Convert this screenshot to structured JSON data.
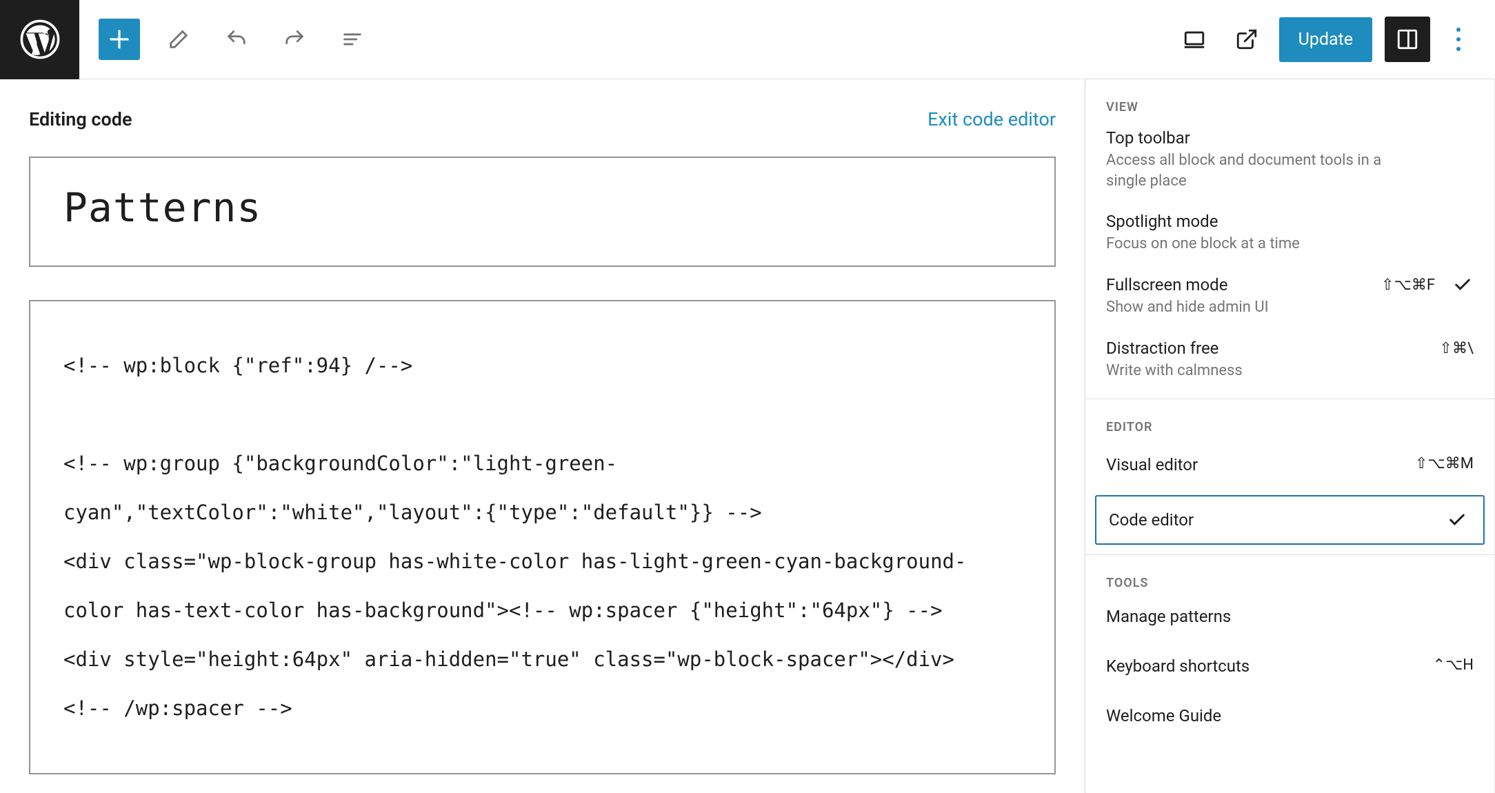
{
  "topbar": {
    "update_label": "Update"
  },
  "editor": {
    "editing_label": "Editing code",
    "exit_link": "Exit code editor",
    "title": "Patterns",
    "code": "<!-- wp:block {\"ref\":94} /-->\n\n<!-- wp:group {\"backgroundColor\":\"light-green-cyan\",\"textColor\":\"white\",\"layout\":{\"type\":\"default\"}} -->\n<div class=\"wp-block-group has-white-color has-light-green-cyan-background-color has-text-color has-background\"><!-- wp:spacer {\"height\":\"64px\"} -->\n<div style=\"height:64px\" aria-hidden=\"true\" class=\"wp-block-spacer\"></div>\n<!-- /wp:spacer -->"
  },
  "panel": {
    "view_label": "VIEW",
    "editor_label": "EDITOR",
    "tools_label": "TOOLS",
    "view_items": [
      {
        "title": "Top toolbar",
        "sub": "Access all block and document tools in a single place",
        "shortcut": "",
        "checked": false
      },
      {
        "title": "Spotlight mode",
        "sub": "Focus on one block at a time",
        "shortcut": "",
        "checked": false
      },
      {
        "title": "Fullscreen mode",
        "sub": "Show and hide admin UI",
        "shortcut": "⇧⌥⌘F",
        "checked": true
      },
      {
        "title": "Distraction free",
        "sub": "Write with calmness",
        "shortcut": "⇧⌘\\",
        "checked": false
      }
    ],
    "editor_items": [
      {
        "title": "Visual editor",
        "shortcut": "⇧⌥⌘M",
        "selected": false
      },
      {
        "title": "Code editor",
        "shortcut": "",
        "selected": true
      }
    ],
    "tool_items": [
      {
        "title": "Manage patterns",
        "shortcut": ""
      },
      {
        "title": "Keyboard shortcuts",
        "shortcut": "⌃⌥H"
      },
      {
        "title": "Welcome Guide",
        "shortcut": ""
      }
    ]
  }
}
